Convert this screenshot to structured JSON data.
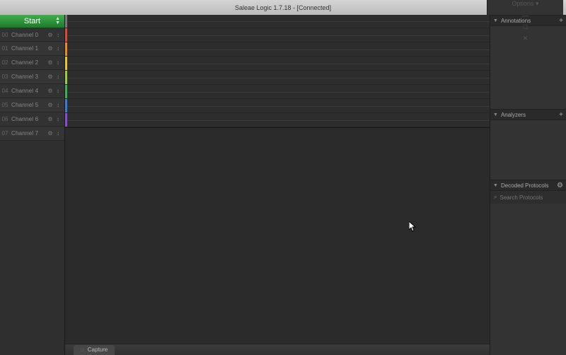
{
  "titlebar": {
    "title": "Saleae Logic 1.7.18 - [Connected]",
    "options_label": "Options ▾",
    "min": "—",
    "max": "□",
    "close": "✕"
  },
  "start_button": {
    "label": "Start"
  },
  "channels": [
    {
      "idx": "00",
      "name": "Channel 0",
      "color": "#7a7a7a"
    },
    {
      "idx": "01",
      "name": "Channel 1",
      "color": "#d94a3a"
    },
    {
      "idx": "02",
      "name": "Channel 2",
      "color": "#e58a2e"
    },
    {
      "idx": "03",
      "name": "Channel 3",
      "color": "#e8c43a"
    },
    {
      "idx": "04",
      "name": "Channel 4",
      "color": "#9acb4a"
    },
    {
      "idx": "05",
      "name": "Channel 5",
      "color": "#3fae55"
    },
    {
      "idx": "06",
      "name": "Channel 6",
      "color": "#3a7bd5"
    },
    {
      "idx": "07",
      "name": "Channel 7",
      "color": "#8a4bd0"
    }
  ],
  "gear_glyph": "⚙",
  "trigger_glyph": "↕",
  "panels": {
    "annotations": {
      "title": "Annotations",
      "action": "+"
    },
    "analyzers": {
      "title": "Analyzers",
      "action": "+"
    },
    "decoded": {
      "title": "Decoded Protocols",
      "action": "⚙"
    }
  },
  "search": {
    "placeholder": "Search Protocols",
    "icon": "⌕"
  },
  "footer": {
    "capture_tab": "Capture",
    "tab_icon": "◌"
  },
  "scroll": {
    "left": "◀",
    "right": "▶"
  }
}
